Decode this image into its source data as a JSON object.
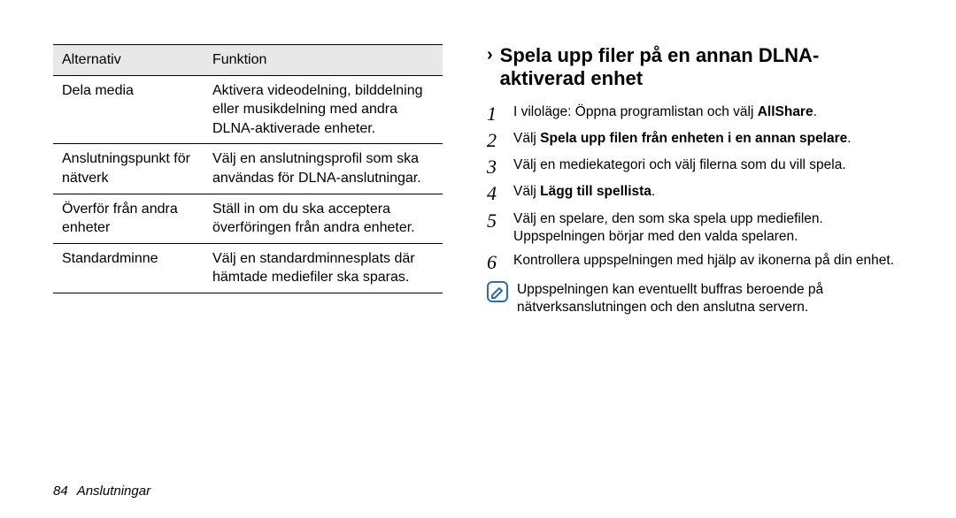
{
  "table": {
    "headers": {
      "alt": "Alternativ",
      "fn": "Funktion"
    },
    "rows": [
      {
        "alt": "Dela media",
        "fn": "Aktivera videodelning, bilddelning eller musikdelning med andra DLNA-aktiverade enheter."
      },
      {
        "alt": "Anslutningspunkt för nätverk",
        "fn": "Välj en anslutningsprofil som ska användas för DLNA-anslutningar."
      },
      {
        "alt": "Överför från andra enheter",
        "fn": "Ställ in om du ska acceptera överföringen från andra enheter."
      },
      {
        "alt": "Standardminne",
        "fn": "Välj en standardminnesplats där hämtade mediefiler ska sparas."
      }
    ]
  },
  "heading": "Spela upp filer på en annan DLNA-aktiverad enhet",
  "steps": [
    {
      "num": "1",
      "pre": "I viloläge: Öppna programlistan och välj ",
      "bold": "AllShare",
      "post": "."
    },
    {
      "num": "2",
      "pre": "Välj ",
      "bold": "Spela upp filen från enheten i en annan spelare",
      "post": "."
    },
    {
      "num": "3",
      "pre": "Välj en mediekategori och välj filerna som du vill spela.",
      "bold": "",
      "post": ""
    },
    {
      "num": "4",
      "pre": "Välj ",
      "bold": "Lägg till spellista",
      "post": "."
    },
    {
      "num": "5",
      "pre": "Välj en spelare, den som ska spela upp mediefilen. Uppspelningen börjar med den valda spelaren.",
      "bold": "",
      "post": ""
    },
    {
      "num": "6",
      "pre": "Kontrollera uppspelningen med hjälp av ikonerna på din enhet.",
      "bold": "",
      "post": ""
    }
  ],
  "note": "Uppspelningen kan eventuellt buffras beroende på nätverksanslutningen och den anslutna servern.",
  "footer": {
    "page": "84",
    "section": "Anslutningar"
  }
}
